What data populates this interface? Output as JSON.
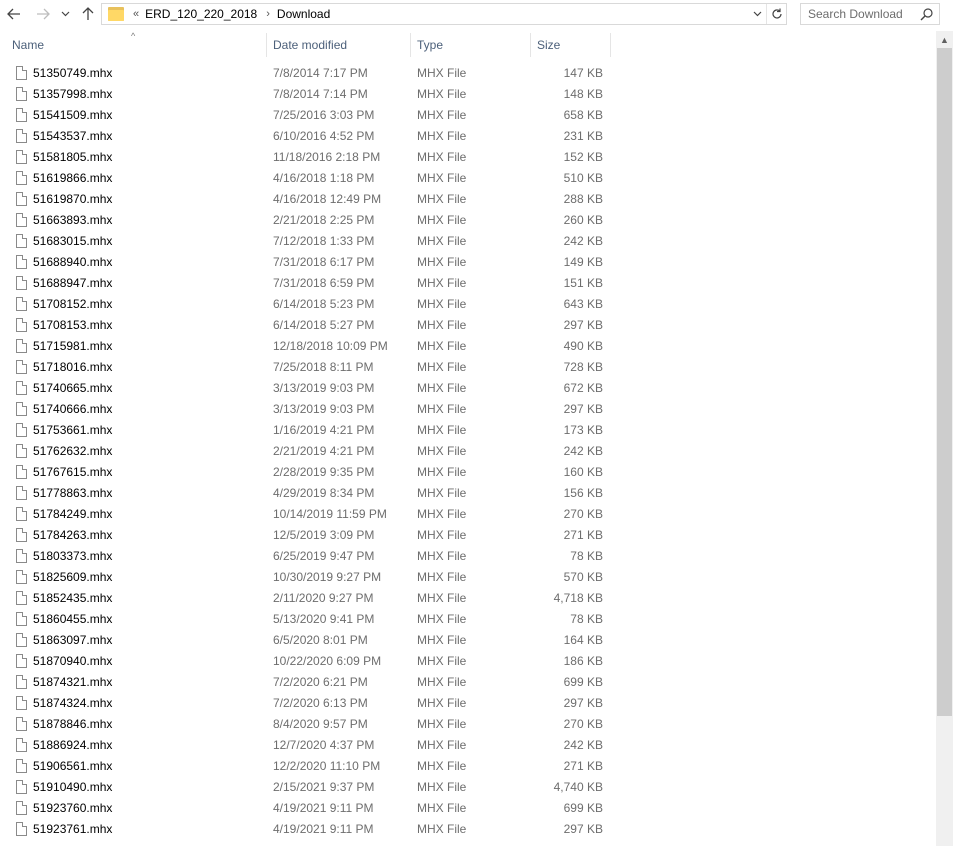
{
  "toolbar": {
    "back_icon": "arrow-left-icon",
    "forward_icon": "arrow-right-icon",
    "recent_icon": "chevron-down-icon",
    "up_icon": "arrow-up-icon"
  },
  "address": {
    "overflow_glyph": "«",
    "crumbs": [
      "ERD_120_220_2018",
      "Download"
    ],
    "separator": "›",
    "dropdown_glyph": "⌄",
    "refresh_glyph": "↻"
  },
  "search": {
    "placeholder": "Search Download"
  },
  "columns": {
    "name": "Name",
    "date": "Date modified",
    "type": "Type",
    "size": "Size",
    "sort_glyph": "^"
  },
  "files": [
    {
      "name": "51350749.mhx",
      "date": "7/8/2014 7:17 PM",
      "type": "MHX File",
      "size": "147 KB"
    },
    {
      "name": "51357998.mhx",
      "date": "7/8/2014 7:14 PM",
      "type": "MHX File",
      "size": "148 KB"
    },
    {
      "name": "51541509.mhx",
      "date": "7/25/2016 3:03 PM",
      "type": "MHX File",
      "size": "658 KB"
    },
    {
      "name": "51543537.mhx",
      "date": "6/10/2016 4:52 PM",
      "type": "MHX File",
      "size": "231 KB"
    },
    {
      "name": "51581805.mhx",
      "date": "11/18/2016 2:18 PM",
      "type": "MHX File",
      "size": "152 KB"
    },
    {
      "name": "51619866.mhx",
      "date": "4/16/2018 1:18 PM",
      "type": "MHX File",
      "size": "510 KB"
    },
    {
      "name": "51619870.mhx",
      "date": "4/16/2018 12:49 PM",
      "type": "MHX File",
      "size": "288 KB"
    },
    {
      "name": "51663893.mhx",
      "date": "2/21/2018 2:25 PM",
      "type": "MHX File",
      "size": "260 KB"
    },
    {
      "name": "51683015.mhx",
      "date": "7/12/2018 1:33 PM",
      "type": "MHX File",
      "size": "242 KB"
    },
    {
      "name": "51688940.mhx",
      "date": "7/31/2018 6:17 PM",
      "type": "MHX File",
      "size": "149 KB"
    },
    {
      "name": "51688947.mhx",
      "date": "7/31/2018 6:59 PM",
      "type": "MHX File",
      "size": "151 KB"
    },
    {
      "name": "51708152.mhx",
      "date": "6/14/2018 5:23 PM",
      "type": "MHX File",
      "size": "643 KB"
    },
    {
      "name": "51708153.mhx",
      "date": "6/14/2018 5:27 PM",
      "type": "MHX File",
      "size": "297 KB"
    },
    {
      "name": "51715981.mhx",
      "date": "12/18/2018 10:09 PM",
      "type": "MHX File",
      "size": "490 KB"
    },
    {
      "name": "51718016.mhx",
      "date": "7/25/2018 8:11 PM",
      "type": "MHX File",
      "size": "728 KB"
    },
    {
      "name": "51740665.mhx",
      "date": "3/13/2019 9:03 PM",
      "type": "MHX File",
      "size": "672 KB"
    },
    {
      "name": "51740666.mhx",
      "date": "3/13/2019 9:03 PM",
      "type": "MHX File",
      "size": "297 KB"
    },
    {
      "name": "51753661.mhx",
      "date": "1/16/2019 4:21 PM",
      "type": "MHX File",
      "size": "173 KB"
    },
    {
      "name": "51762632.mhx",
      "date": "2/21/2019 4:21 PM",
      "type": "MHX File",
      "size": "242 KB"
    },
    {
      "name": "51767615.mhx",
      "date": "2/28/2019 9:35 PM",
      "type": "MHX File",
      "size": "160 KB"
    },
    {
      "name": "51778863.mhx",
      "date": "4/29/2019 8:34 PM",
      "type": "MHX File",
      "size": "156 KB"
    },
    {
      "name": "51784249.mhx",
      "date": "10/14/2019 11:59 PM",
      "type": "MHX File",
      "size": "270 KB"
    },
    {
      "name": "51784263.mhx",
      "date": "12/5/2019 3:09 PM",
      "type": "MHX File",
      "size": "271 KB"
    },
    {
      "name": "51803373.mhx",
      "date": "6/25/2019 9:47 PM",
      "type": "MHX File",
      "size": "78 KB"
    },
    {
      "name": "51825609.mhx",
      "date": "10/30/2019 9:27 PM",
      "type": "MHX File",
      "size": "570 KB"
    },
    {
      "name": "51852435.mhx",
      "date": "2/11/2020 9:27 PM",
      "type": "MHX File",
      "size": "4,718 KB"
    },
    {
      "name": "51860455.mhx",
      "date": "5/13/2020 9:41 PM",
      "type": "MHX File",
      "size": "78 KB"
    },
    {
      "name": "51863097.mhx",
      "date": "6/5/2020 8:01 PM",
      "type": "MHX File",
      "size": "164 KB"
    },
    {
      "name": "51870940.mhx",
      "date": "10/22/2020 6:09 PM",
      "type": "MHX File",
      "size": "186 KB"
    },
    {
      "name": "51874321.mhx",
      "date": "7/2/2020 6:21 PM",
      "type": "MHX File",
      "size": "699 KB"
    },
    {
      "name": "51874324.mhx",
      "date": "7/2/2020 6:13 PM",
      "type": "MHX File",
      "size": "297 KB"
    },
    {
      "name": "51878846.mhx",
      "date": "8/4/2020 9:57 PM",
      "type": "MHX File",
      "size": "270 KB"
    },
    {
      "name": "51886924.mhx",
      "date": "12/7/2020 4:37 PM",
      "type": "MHX File",
      "size": "242 KB"
    },
    {
      "name": "51906561.mhx",
      "date": "12/2/2020 11:10 PM",
      "type": "MHX File",
      "size": "271 KB"
    },
    {
      "name": "51910490.mhx",
      "date": "2/15/2021 9:37 PM",
      "type": "MHX File",
      "size": "4,740 KB"
    },
    {
      "name": "51923760.mhx",
      "date": "4/19/2021 9:11 PM",
      "type": "MHX File",
      "size": "699 KB"
    },
    {
      "name": "51923761.mhx",
      "date": "4/19/2021 9:11 PM",
      "type": "MHX File",
      "size": "297 KB"
    }
  ],
  "scrollbar": {
    "up_glyph": "▲"
  }
}
